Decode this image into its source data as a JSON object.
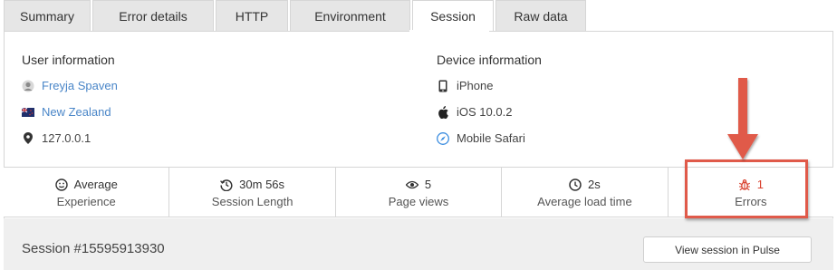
{
  "tabs": [
    {
      "label": "Summary",
      "active": false
    },
    {
      "label": "Error details",
      "active": false
    },
    {
      "label": "HTTP",
      "active": false
    },
    {
      "label": "Environment",
      "active": false
    },
    {
      "label": "Session",
      "active": true
    },
    {
      "label": "Raw data",
      "active": false
    }
  ],
  "user_info": {
    "title": "User information",
    "name": "Freyja Spaven",
    "country": "New Zealand",
    "ip": "127.0.0.1"
  },
  "device_info": {
    "title": "Device information",
    "device": "iPhone",
    "os": "iOS 10.0.2",
    "browser": "Mobile Safari"
  },
  "metrics": [
    {
      "value": "Average",
      "label": "Experience",
      "icon": "smiley-icon"
    },
    {
      "value": "30m 56s",
      "label": "Session Length",
      "icon": "history-icon"
    },
    {
      "value": "5",
      "label": "Page views",
      "icon": "eye-icon"
    },
    {
      "value": "2s",
      "label": "Average load time",
      "icon": "clock-icon"
    },
    {
      "value": "1",
      "label": "Errors",
      "icon": "bug-icon"
    }
  ],
  "session": {
    "title": "Session #15595913930",
    "pulse_button": "View session in Pulse"
  },
  "colors": {
    "link": "#4a86c8",
    "error": "#d9412e",
    "highlight": "#e05a4a"
  }
}
